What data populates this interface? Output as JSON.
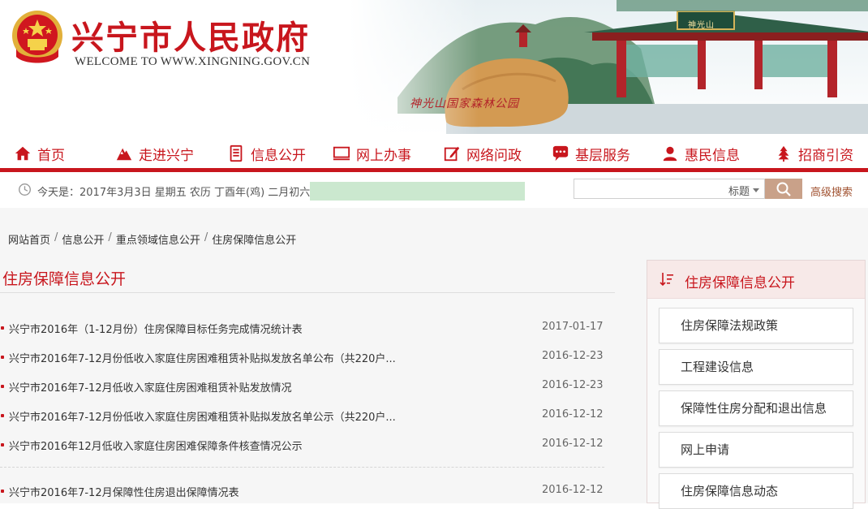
{
  "header": {
    "site_title": "兴宁市人民政府",
    "site_subtitle": "WELCOME TO WWW.XINGNING.GOV.CN",
    "banner_park_label": "神光山国家森林公园",
    "banner_gate_plaque": "神光山"
  },
  "nav": {
    "items": [
      {
        "label": "首页",
        "icon": "home-icon"
      },
      {
        "label": "走进兴宁",
        "icon": "mountain-icon"
      },
      {
        "label": "信息公开",
        "icon": "document-icon"
      },
      {
        "label": "网上办事",
        "icon": "monitor-icon"
      },
      {
        "label": "网络问政",
        "icon": "edit-icon"
      },
      {
        "label": "基层服务",
        "icon": "chat-icon"
      },
      {
        "label": "惠民信息",
        "icon": "user-icon"
      },
      {
        "label": "招商引资",
        "icon": "tree-icon"
      }
    ],
    "accent_color": "#c8161d"
  },
  "info_bar": {
    "date_text": "今天是：2017年3月3日 星期五 农历 丁酉年(鸡) 二月初六",
    "search_placeholder": "",
    "search_scope": "标题",
    "advanced_search": "高级搜索"
  },
  "breadcrumb": [
    "网站首页",
    "信息公开",
    "重点领域信息公开",
    "住房保障信息公开"
  ],
  "main": {
    "title": "住房保障信息公开",
    "news": [
      {
        "title": "兴宁市2016年（1-12月份）住房保障目标任务完成情况统计表",
        "date": "2017-01-17"
      },
      {
        "title": "兴宁市2016年7-12月份低收入家庭住房困难租赁补贴拟发放名单公布（共220户...",
        "date": "2016-12-23"
      },
      {
        "title": "兴宁市2016年7-12月低收入家庭住房困难租赁补贴发放情况",
        "date": "2016-12-23"
      },
      {
        "title": "兴宁市2016年7-12月份低收入家庭住房困难租赁补贴拟发放名单公示（共220户...",
        "date": "2016-12-12"
      },
      {
        "title": "兴宁市2016年12月低收入家庭住房困难保障条件核查情况公示",
        "date": "2016-12-12"
      },
      {
        "title": "兴宁市2016年7-12月保障性住房退出保障情况表",
        "date": "2016-12-12"
      }
    ]
  },
  "sidebar": {
    "title": "住房保障信息公开",
    "items": [
      "住房保障法规政策",
      "工程建设信息",
      "保障性住房分配和退出信息",
      "网上申请",
      "住房保障信息动态"
    ]
  }
}
